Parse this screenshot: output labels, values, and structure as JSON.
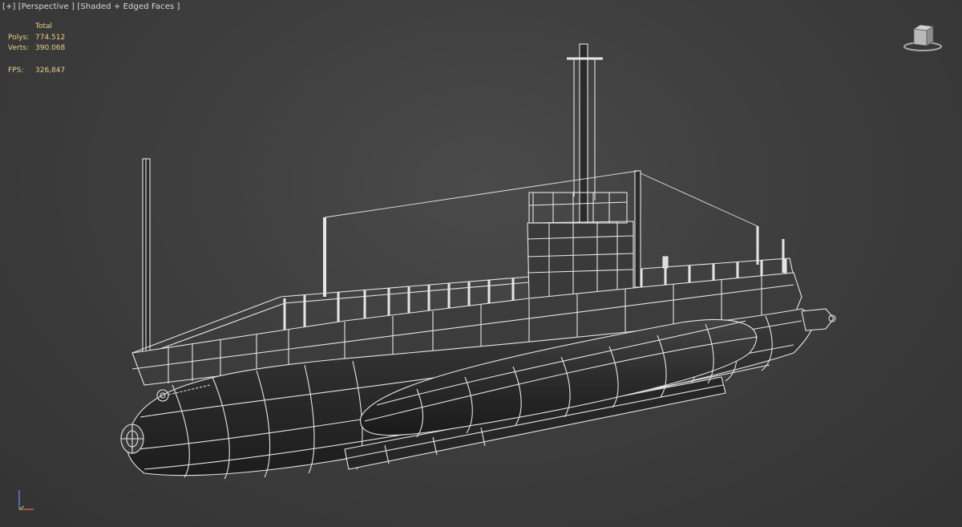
{
  "viewport": {
    "label_plus": "[+]",
    "label_view": "[Perspective ]",
    "label_shading": "[Shaded + Edged Faces ]"
  },
  "stats": {
    "header": "Total",
    "polys_label": "Polys:",
    "polys_value": "774.512",
    "verts_label": "Verts:",
    "verts_value": "390.068",
    "fps_label": "FPS:",
    "fps_value": "326,847"
  },
  "colors": {
    "background": "#3b3b3b",
    "stats_text": "#e7cf8a",
    "wireframe": "#e6e6e6",
    "hull_shade": "#262626"
  },
  "icons": {
    "viewcube": "viewcube-icon",
    "axis": "axis-tripod-icon"
  }
}
